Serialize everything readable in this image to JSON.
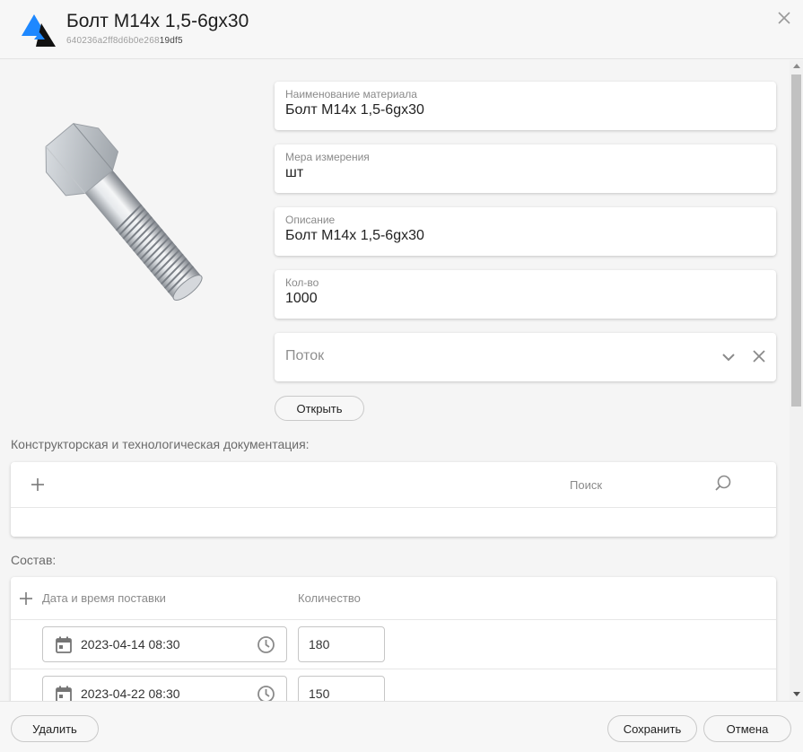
{
  "header": {
    "title": "Болт M14x 1,5-6gx30",
    "id_prefix": "640236a2ff8d6b0e268",
    "id_suffix": "19df5",
    "logo_icon": "app-logo-icon",
    "close_icon": "close-icon"
  },
  "form": {
    "name": {
      "label": "Наименование материала",
      "value": "Болт M14x 1,5-6gx30"
    },
    "unit": {
      "label": "Мера измерения",
      "value": "шт"
    },
    "description": {
      "label": "Описание",
      "value": "Болт M14x 1,5-6gx30"
    },
    "quantity": {
      "label": "Кол-во",
      "value": "1000"
    },
    "stream": {
      "placeholder": "Поток"
    },
    "open_button": "Открыть"
  },
  "docs": {
    "label": "Конструкторская и технологическая документация:",
    "search_placeholder": "Поиск"
  },
  "composition": {
    "label": "Состав:",
    "col_date": "Дата и время поставки",
    "col_qty": "Количество",
    "rows": [
      {
        "datetime": "2023-04-14 08:30",
        "qty": "180"
      },
      {
        "datetime": "2023-04-22 08:30",
        "qty": "150"
      }
    ]
  },
  "footer": {
    "delete": "Удалить",
    "save": "Сохранить",
    "cancel": "Отмена"
  },
  "colors": {
    "logo_blue": "#1e88ff",
    "logo_dark": "#1a1a1a",
    "icon_gray": "#9a9a9a"
  }
}
